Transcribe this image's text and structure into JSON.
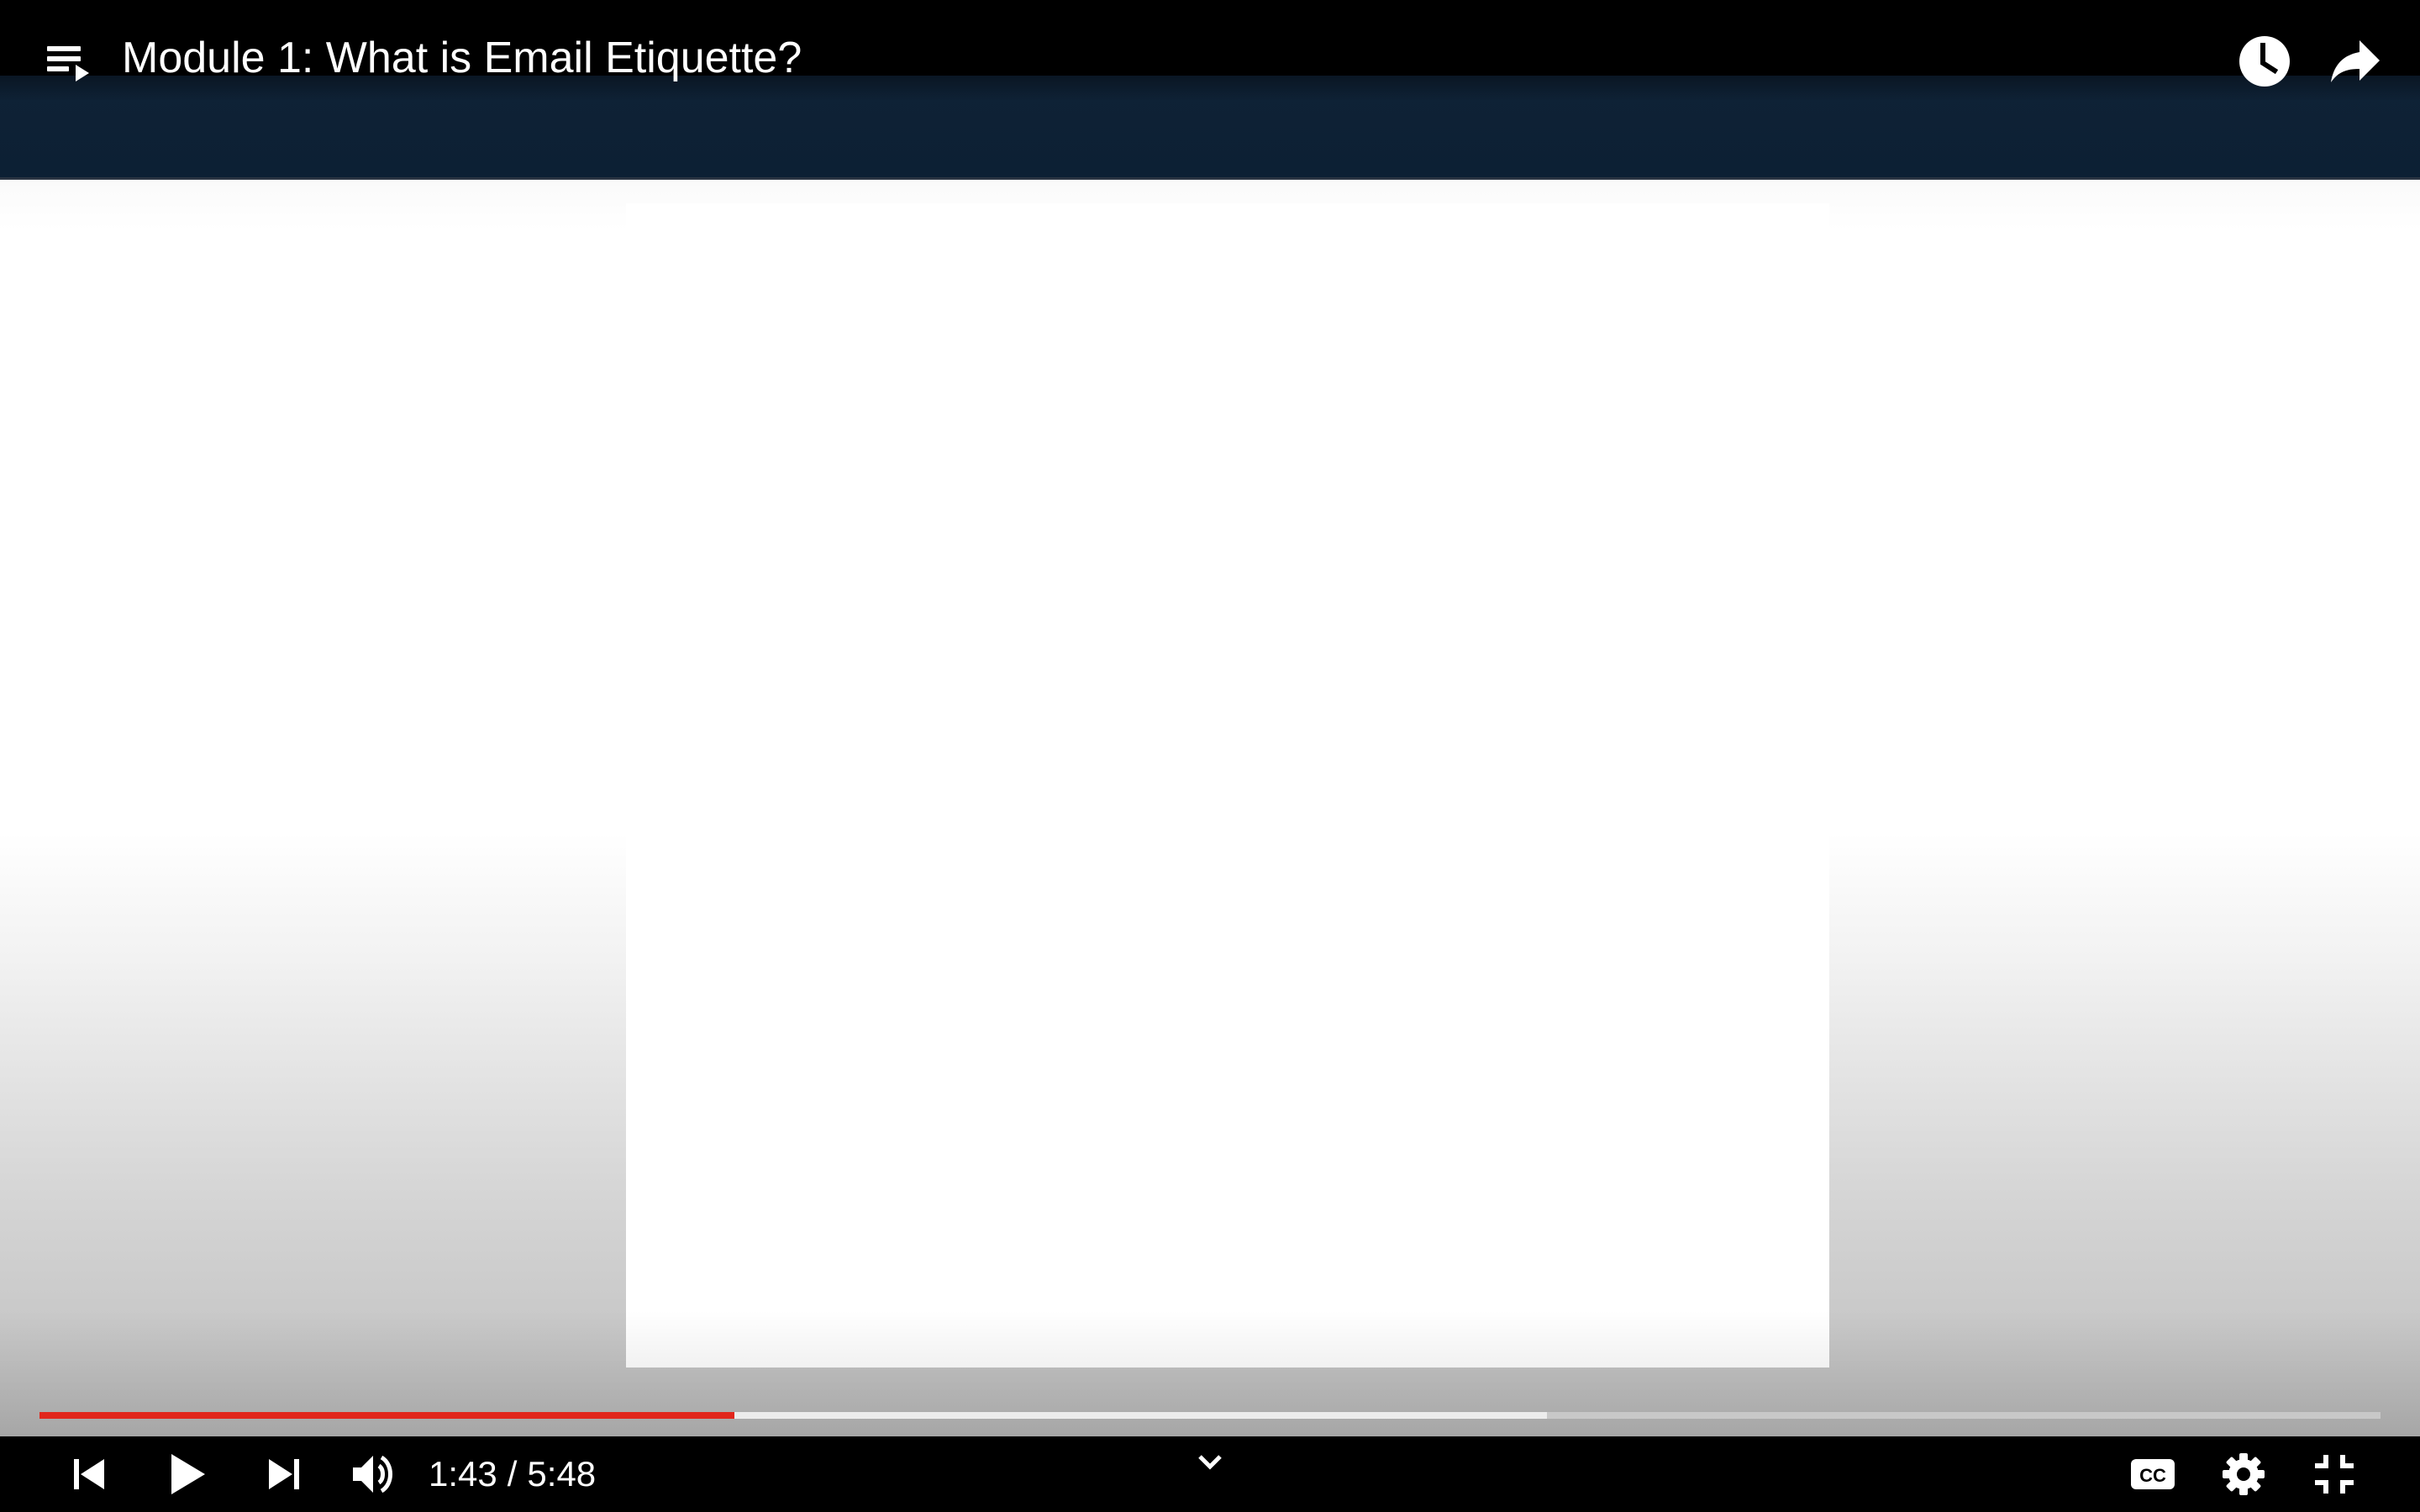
{
  "header": {
    "title": "Module 1: What is Email Etiquette?",
    "icons": [
      "playlist-icon",
      "watch-later-icon",
      "share-icon"
    ]
  },
  "playback": {
    "current_time": "1:43",
    "separator": "/",
    "duration": "5:48",
    "played_fraction": 0.297,
    "buffered_fraction": 0.644,
    "state": "paused"
  },
  "controls": {
    "icons": [
      "previous-icon",
      "play-icon",
      "next-icon",
      "volume-icon",
      "chevron-down-icon",
      "captions-icon",
      "settings-icon",
      "exit-fullscreen-icon"
    ]
  },
  "colors": {
    "accent": "#e1261c",
    "bar": "#000000",
    "frame_band": "#0f2236"
  }
}
